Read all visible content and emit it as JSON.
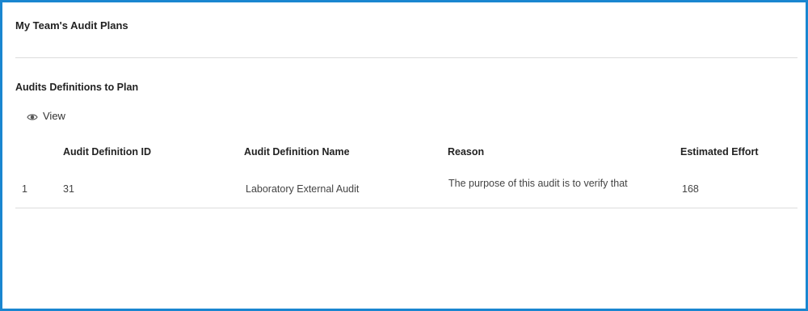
{
  "page": {
    "title": "My Team's Audit Plans"
  },
  "section": {
    "title": "Audits Definitions to Plan"
  },
  "toolbar": {
    "view_label": "View",
    "view_icon": "eye-icon"
  },
  "table": {
    "columns": [
      "Audit Definition ID",
      "Audit Definition Name",
      "Reason",
      "Estimated Effort"
    ],
    "rows": [
      {
        "index": "1",
        "id": "31",
        "name": "Laboratory External Audit",
        "reason": "The purpose of this audit is to verify that",
        "effort": "168"
      }
    ]
  },
  "colors": {
    "frame_border": "#1a86d0",
    "divider": "#dddddd"
  }
}
